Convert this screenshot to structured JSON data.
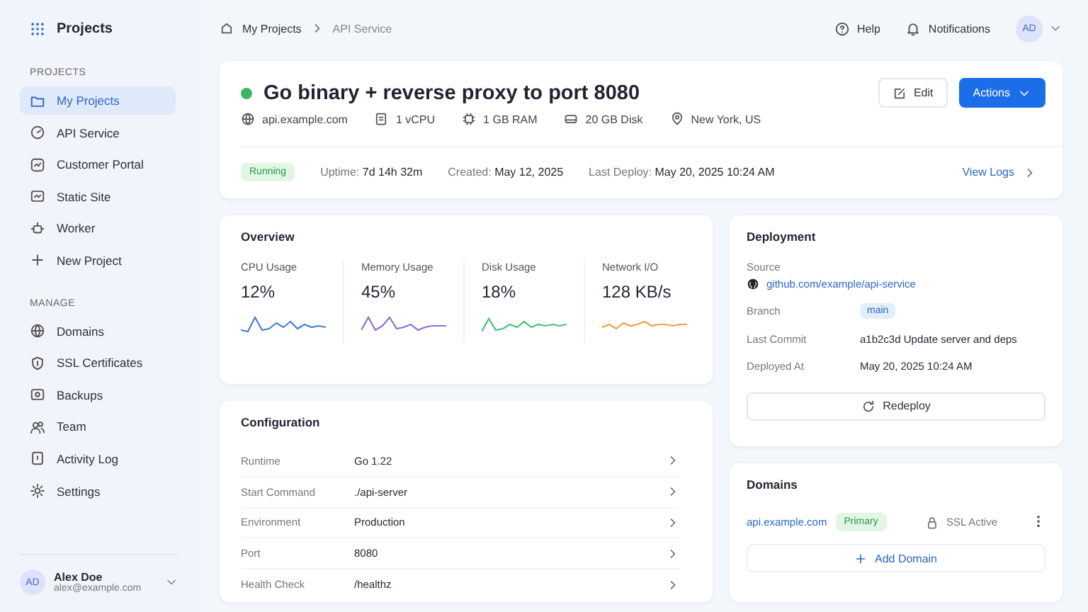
{
  "sidebar": {
    "logo": "Projects",
    "sections": [
      {
        "heading": "PROJECTS",
        "items": [
          {
            "label": "My Projects",
            "selected": true
          },
          {
            "label": "API Service",
            "selected": false
          },
          {
            "label": "Customer Portal",
            "selected": false
          },
          {
            "label": "Static Site",
            "selected": false
          },
          {
            "label": "Worker",
            "selected": false
          },
          {
            "label": "New Project",
            "selected": false
          }
        ]
      },
      {
        "heading": "MANAGE",
        "items": [
          {
            "label": "Domains",
            "selected": false
          },
          {
            "label": "SSL Certificates",
            "selected": false
          },
          {
            "label": "Backups",
            "selected": false
          },
          {
            "label": "Team",
            "selected": false
          },
          {
            "label": "Activity Log",
            "selected": false
          },
          {
            "label": "Settings",
            "selected": false
          }
        ]
      }
    ],
    "user": {
      "initials": "AD",
      "name": "Alex Doe",
      "email": "alex@example.com"
    }
  },
  "breadcrumb": [
    "My Projects",
    "API Service"
  ],
  "topbar": {
    "help": "Help",
    "notifications": "Notifications",
    "avatar": "AD"
  },
  "project": {
    "title": "Go binary + reverse proxy to port 8080",
    "running": true,
    "meta": [
      "api.example.com",
      "1 vCPU",
      "1 GB RAM",
      "20 GB Disk",
      "New York, US"
    ],
    "actions": {
      "edit": "Edit",
      "primary": "Actions"
    },
    "status": "Running",
    "stats": [
      {
        "label": "Uptime:",
        "value": "7d 14h 32m"
      },
      {
        "label": "Created:",
        "value": "May 12, 2025"
      },
      {
        "label": "Last Deploy:",
        "value": "May 20, 2025 10:24 AM"
      }
    ],
    "view_logs": "View Logs"
  },
  "overview": {
    "title": "Overview",
    "metrics": [
      {
        "label": "CPU Usage",
        "value": "12%",
        "color": "#4a7fd0"
      },
      {
        "label": "Memory Usage",
        "value": "45%",
        "color": "#8b6fd6"
      },
      {
        "label": "Disk Usage",
        "value": "18%",
        "color": "#4cbf7a"
      },
      {
        "label": "Network I/O",
        "value": "128 KB/s",
        "color": "#f0a040"
      }
    ]
  },
  "configuration": {
    "title": "Configuration",
    "rows": [
      {
        "label": "Runtime",
        "value": "Go 1.22"
      },
      {
        "label": "Start Command",
        "value": "./api-server"
      },
      {
        "label": "Environment",
        "value": "Production"
      },
      {
        "label": "Port",
        "value": "8080"
      },
      {
        "label": "Health Check",
        "value": "/healthz"
      }
    ]
  },
  "deployment": {
    "title": "Deployment",
    "source_label": "Source",
    "source": "github.com/example/api-service",
    "rows": [
      {
        "label": "Branch",
        "value": "main",
        "kind": "tag"
      },
      {
        "label": "Last Commit",
        "value": "a1b2c3d Update server and deps",
        "kind": "text"
      },
      {
        "label": "Deployed At",
        "value": "May 20, 2025 10:24 AM",
        "kind": "text"
      }
    ],
    "redeploy": "Redeploy"
  },
  "domains": {
    "title": "Domains",
    "items": [
      {
        "domain": "api.example.com",
        "badge": "Primary",
        "ssl": "SSL Active"
      }
    ],
    "add": "Add Domain"
  }
}
